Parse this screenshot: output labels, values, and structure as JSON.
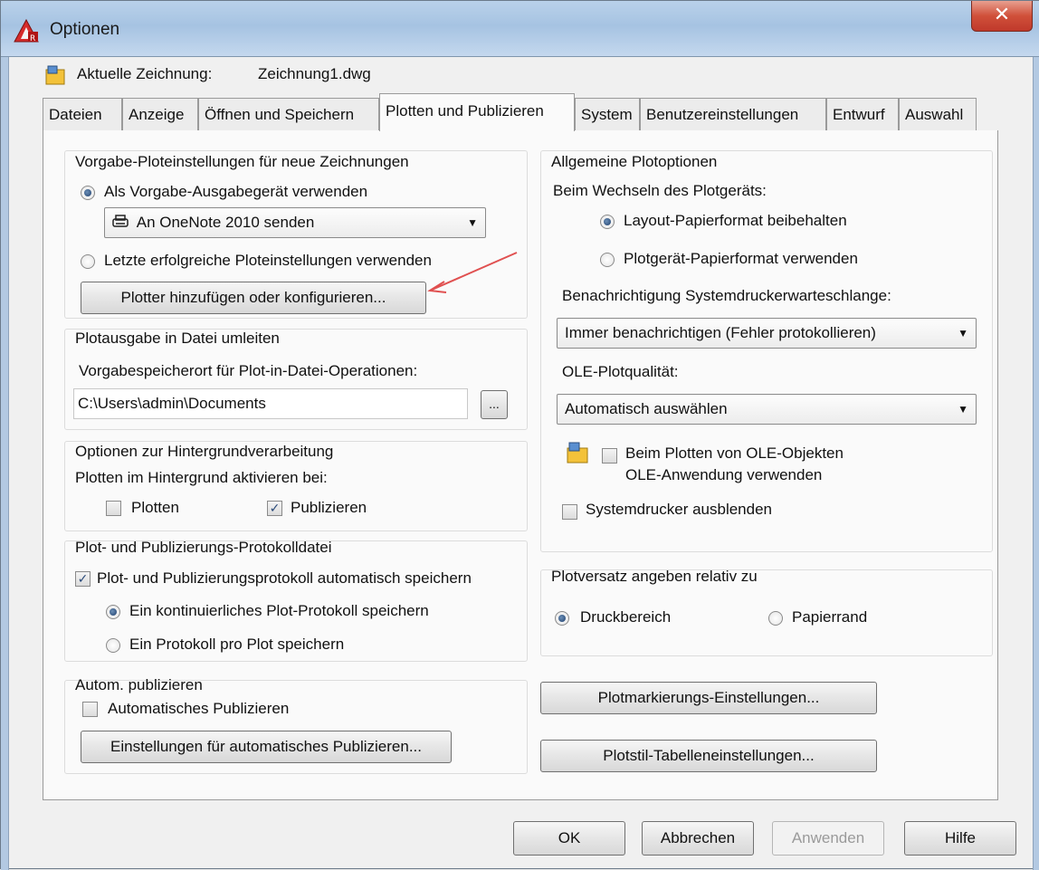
{
  "window": {
    "title": "Optionen",
    "close_label": "✕"
  },
  "drawing": {
    "label": "Aktuelle Zeichnung:",
    "name": "Zeichnung1.dwg"
  },
  "tabs": [
    {
      "label": "Dateien"
    },
    {
      "label": "Anzeige"
    },
    {
      "label": "Öffnen und Speichern"
    },
    {
      "label": "Plotten und Publizieren"
    },
    {
      "label": "System"
    },
    {
      "label": "Benutzereinstellungen"
    },
    {
      "label": "Entwurf"
    },
    {
      "label": "Auswahl"
    }
  ],
  "left": {
    "defaults": {
      "title": "Vorgabe-Ploteinstellungen für neue Zeichnungen",
      "radio_default_device": "Als Vorgabe-Ausgabegerät verwenden",
      "device_value": "An OneNote 2010 senden",
      "radio_last_settings": "Letzte erfolgreiche Ploteinstellungen verwenden",
      "add_plotter_button": "Plotter hinzufügen oder konfigurieren..."
    },
    "redirect": {
      "title": "Plotausgabe in Datei umleiten",
      "path_label": "Vorgabespeicherort für Plot-in-Datei-Operationen:",
      "path_value": "C:\\Users\\admin\\Documents",
      "browse_label": "..."
    },
    "background": {
      "title": "Optionen zur Hintergrundverarbeitung",
      "subtitle": "Plotten im Hintergrund aktivieren bei:",
      "plot_label": "Plotten",
      "publish_label": "Publizieren"
    },
    "logfile": {
      "title": "Plot- und Publizierungs-Protokolldatei",
      "auto_save_label": "Plot- und Publizierungsprotokoll automatisch speichern",
      "continuous_label": "Ein kontinuierliches Plot-Protokoll speichern",
      "per_plot_label": "Ein Protokoll pro Plot speichern"
    },
    "autopublish": {
      "title": "Autom. publizieren",
      "checkbox_label": "Automatisches Publizieren",
      "settings_button": "Einstellungen für automatisches Publizieren..."
    }
  },
  "right": {
    "general": {
      "title": "Allgemeine Plotoptionen",
      "device_change_label": "Beim Wechseln des Plotgeräts:",
      "keep_layout_label": "Layout-Papierformat beibehalten",
      "use_device_label": "Plotgerät-Papierformat verwenden",
      "spool_label": "Benachrichtigung Systemdruckerwarteschlange:",
      "spool_value": "Immer benachrichtigen (Fehler protokollieren)",
      "ole_quality_label": "OLE-Plotqualität:",
      "ole_quality_value": "Automatisch auswählen",
      "ole_app_label_line1": "Beim Plotten von OLE-Objekten",
      "ole_app_label_line2": "OLE-Anwendung verwenden",
      "hide_printers_label": "Systemdrucker ausblenden"
    },
    "offset": {
      "title": "Plotversatz angeben relativ zu",
      "printable_label": "Druckbereich",
      "paper_edge_label": "Papierrand"
    },
    "stamp_button": "Plotmarkierungs-Einstellungen...",
    "plotstyle_button": "Plotstil-Tabelleneinstellungen..."
  },
  "footer": {
    "ok": "OK",
    "cancel": "Abbrechen",
    "apply": "Anwenden",
    "help": "Hilfe"
  },
  "colors": {
    "titlebar": "#a6c3e2",
    "close": "#c0392b",
    "annotation_arrow": "#e05050",
    "radio_dot": "#1f3f6b"
  }
}
